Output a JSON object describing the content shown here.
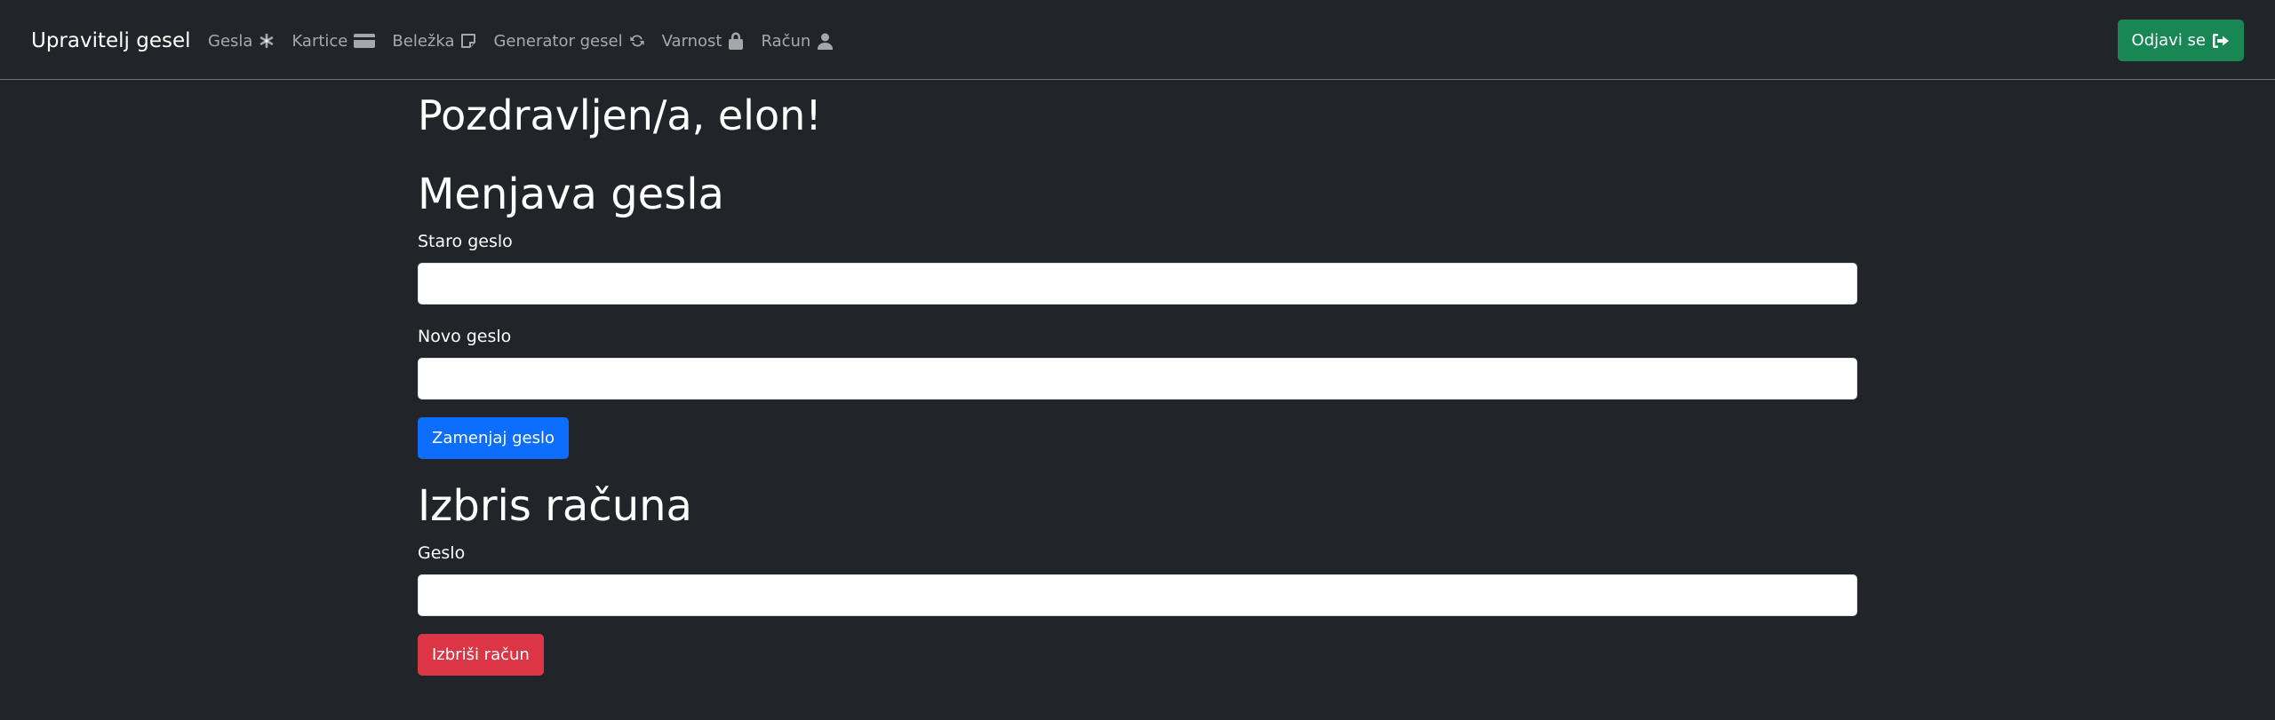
{
  "navbar": {
    "brand": "Upravitelj gesel",
    "links": [
      {
        "label": "Gesla",
        "icon": "asterisk-icon"
      },
      {
        "label": "Kartice",
        "icon": "credit-card-icon"
      },
      {
        "label": "Beležka",
        "icon": "sticky-note-icon"
      },
      {
        "label": "Generator gesel",
        "icon": "refresh-icon"
      },
      {
        "label": "Varnost",
        "icon": "lock-icon"
      },
      {
        "label": "Račun",
        "icon": "user-icon"
      }
    ],
    "logout_label": "Odjavi se",
    "logout_icon": "sign-out-icon"
  },
  "main": {
    "greeting": "Pozdravljen/a, elon!",
    "change_password": {
      "title": "Menjava gesla",
      "old_label": "Staro geslo",
      "old_value": "",
      "new_label": "Novo geslo",
      "new_value": "",
      "submit_label": "Zamenjaj geslo"
    },
    "delete_account": {
      "title": "Izbris računa",
      "password_label": "Geslo",
      "password_value": "",
      "submit_label": "Izbriši račun"
    }
  },
  "colors": {
    "background": "#212529",
    "primary": "#0d6efd",
    "success": "#198754",
    "danger": "#dc3545",
    "nav_muted": "rgba(255,255,255,0.60)"
  }
}
